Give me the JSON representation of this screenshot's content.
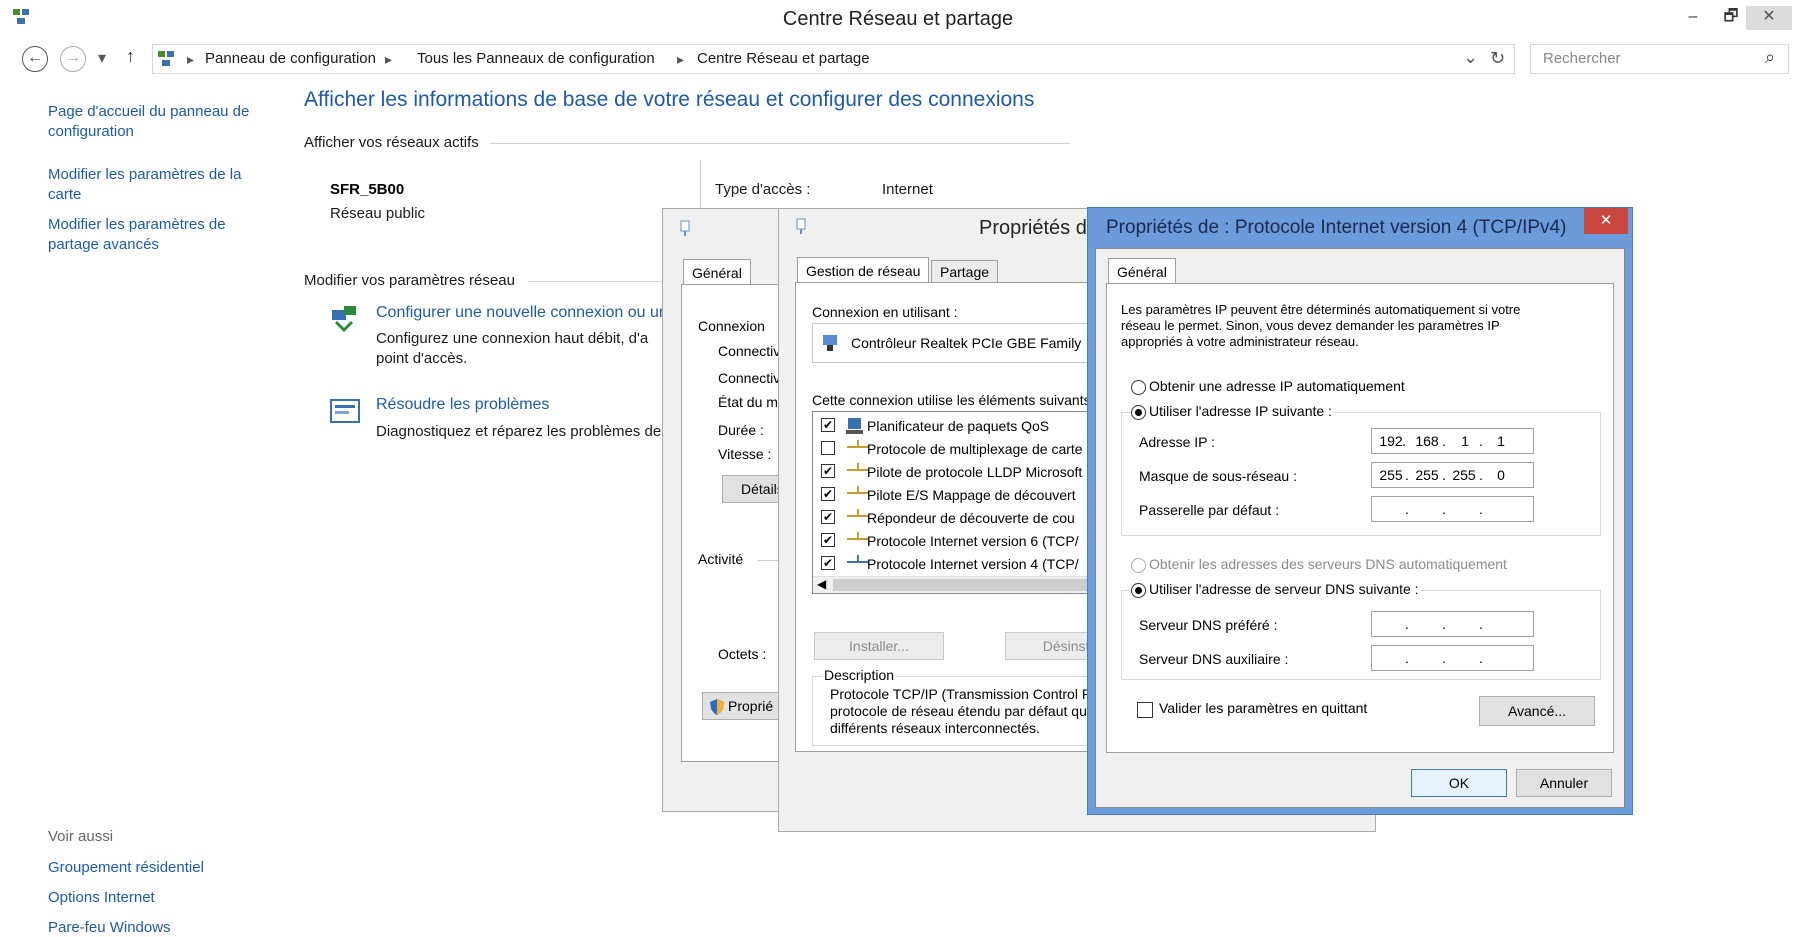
{
  "window": {
    "title": "Centre Réseau et partage",
    "minimize": "–",
    "maximize": "🗗",
    "close": "✕"
  },
  "nav": {
    "back": "←",
    "forward": "→",
    "dropdown": "▾",
    "up": "↑",
    "breadcrumb": [
      "Panneau de configuration",
      "Tous les Panneaux de configuration",
      "Centre Réseau et partage"
    ],
    "sep": "▸",
    "refresh": "↻",
    "history": "⌄",
    "search_placeholder": "Rechercher",
    "search_icon": "⌕"
  },
  "sidebar": {
    "links": [
      "Page d'accueil du panneau de",
      "configuration",
      "Modifier les paramètres de la",
      "carte",
      "Modifier les paramètres de",
      "partage avancés"
    ],
    "see_also": "Voir aussi",
    "see_also_links": [
      "Groupement résidentiel",
      "Options Internet",
      "Pare-feu Windows"
    ]
  },
  "main": {
    "heading": "Afficher les informations de base de votre réseau et configurer des connexions",
    "active_networks": "Afficher vos réseaux actifs",
    "network_name": "SFR_5B00",
    "network_type": "Réseau public",
    "access_type_label": "Type d'accès :",
    "access_type_value": "Internet",
    "change_settings": "Modifier vos paramètres réseau",
    "setup_link": "Configurer une nouvelle connexion ou ur",
    "setup_desc1": "Configurez une connexion haut débit, d'a",
    "setup_desc2": "point d'accès.",
    "troubleshoot_link": "Résoudre les problèmes",
    "troubleshoot_desc": "Diagnostiquez et réparez les problèmes de"
  },
  "status_dialog": {
    "tab": "Général",
    "connexion": "Connexion",
    "rows": [
      "Connectiv",
      "Connectiv",
      "État du m",
      "Durée :",
      "Vitesse :"
    ],
    "details": "Détails",
    "activite": "Activité",
    "octets": "Octets :",
    "properties": "Proprié"
  },
  "props_dialog": {
    "title": "Propriétés de",
    "tabs": [
      "Gestion de réseau",
      "Partage"
    ],
    "connect_using": "Connexion en utilisant :",
    "adapter": "Contrôleur Realtek PCIe GBE Family",
    "uses": "Cette connexion utilise les éléments suivants",
    "items": [
      {
        "checked": true,
        "label": "Planificateur de paquets QoS"
      },
      {
        "checked": false,
        "label": "Protocole de multiplexage de carte"
      },
      {
        "checked": true,
        "label": "Pilote de protocole LLDP Microsoft"
      },
      {
        "checked": true,
        "label": "Pilote E/S Mappage de découvert"
      },
      {
        "checked": true,
        "label": "Répondeur de découverte de cou"
      },
      {
        "checked": true,
        "label": "Protocole Internet version 6 (TCP/"
      },
      {
        "checked": true,
        "label": "Protocole Internet version 4 (TCP/"
      }
    ],
    "install": "Installer...",
    "uninstall": "Désinsta",
    "description_label": "Description",
    "description": [
      "Protocole TCP/IP (Transmission Control P",
      "protocole de réseau étendu par défaut qu",
      "différents réseaux interconnectés."
    ]
  },
  "ipv4_dialog": {
    "title": "Propriétés de : Protocole Internet version 4 (TCP/IPv4)",
    "close": "✕",
    "tab": "Général",
    "intro": [
      "Les paramètres IP peuvent être déterminés automatiquement si votre",
      "réseau le permet. Sinon, vous devez demander les paramètres IP",
      "appropriés à votre administrateur réseau."
    ],
    "auto_ip": "Obtenir une adresse IP automatiquement",
    "manual_ip": "Utiliser l'adresse IP suivante :",
    "ip_label": "Adresse IP :",
    "ip_value": [
      "192",
      "168",
      "1",
      "1"
    ],
    "mask_label": "Masque de sous-réseau :",
    "mask_value": [
      "255",
      "255",
      "255",
      "0"
    ],
    "gateway_label": "Passerelle par défaut :",
    "auto_dns": "Obtenir les adresses des serveurs DNS automatiquement",
    "manual_dns": "Utiliser l'adresse de serveur DNS suivante :",
    "dns1_label": "Serveur DNS préféré :",
    "dns2_label": "Serveur DNS auxiliaire :",
    "validate": "Valider les paramètres en quittant",
    "advanced": "Avancé...",
    "ok": "OK",
    "cancel": "Annuler",
    "dot": "."
  }
}
